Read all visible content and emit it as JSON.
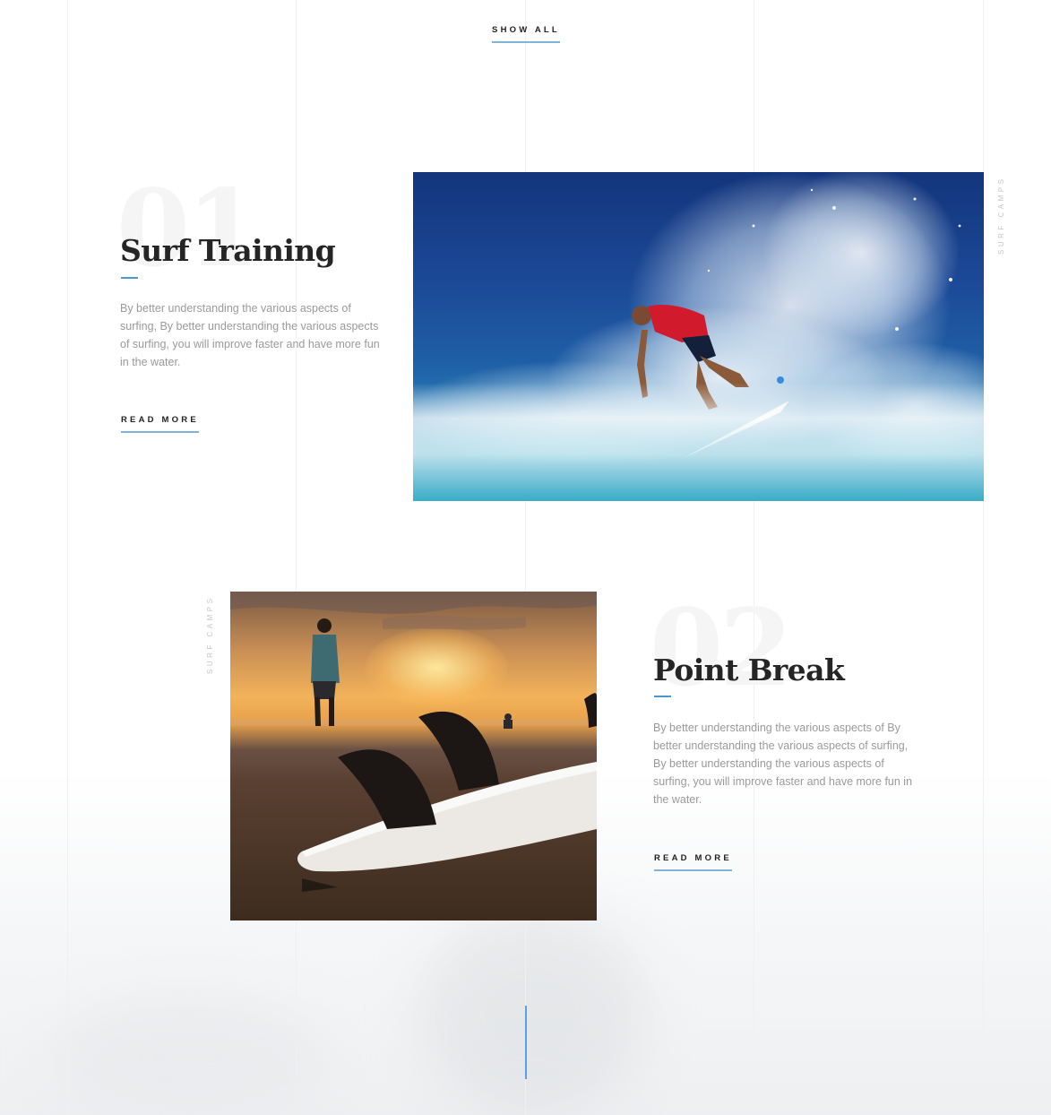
{
  "top": {
    "show_all": "SHOW ALL"
  },
  "items": [
    {
      "number": "01",
      "title": "Surf Training",
      "description": "By better understanding the various aspects of surfing, By better understanding the various aspects of surfing, you will improve faster and have more fun in the water.",
      "read_more": "READ MORE",
      "side_label": "SURF CAMPS",
      "image_alt": "Surfer riding a wave with spray"
    },
    {
      "number": "02",
      "title": "Point Break",
      "description": "By better understanding the various aspects of By better understanding the various aspects of surfing, By better understanding the various aspects of surfing, you will improve faster and have more fun in the water.",
      "read_more": "READ MORE",
      "side_label": "SURF CAMPS",
      "image_alt": "Surfboard fins on the beach at sunset"
    }
  ],
  "colors": {
    "accent": "#4a97d2",
    "underline": "#7fb3dc",
    "heading": "#252525",
    "body_text": "#9a9a9a"
  }
}
